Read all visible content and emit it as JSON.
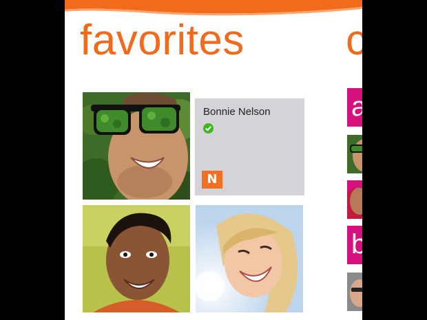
{
  "panorama": {
    "title": "favorites",
    "next_section_title_peek": "c"
  },
  "favorites": [
    {
      "kind": "photo",
      "subject": "man with leaf-covered sunglasses"
    },
    {
      "kind": "card",
      "name": "Bonnie Nelson",
      "status": "online",
      "status_icon": "green-check-icon",
      "service_badge": "N"
    },
    {
      "kind": "photo",
      "subject": "smiling man"
    },
    {
      "kind": "photo",
      "subject": "smiling woman in sunlight"
    }
  ],
  "index_letters": [
    "a",
    "b"
  ],
  "colors": {
    "accent": "#f26a1b",
    "index_tile": "#d4117c",
    "card_bg": "#d4d3d7",
    "status_green": "#3cb81b",
    "badge_orange": "#f36f21"
  }
}
